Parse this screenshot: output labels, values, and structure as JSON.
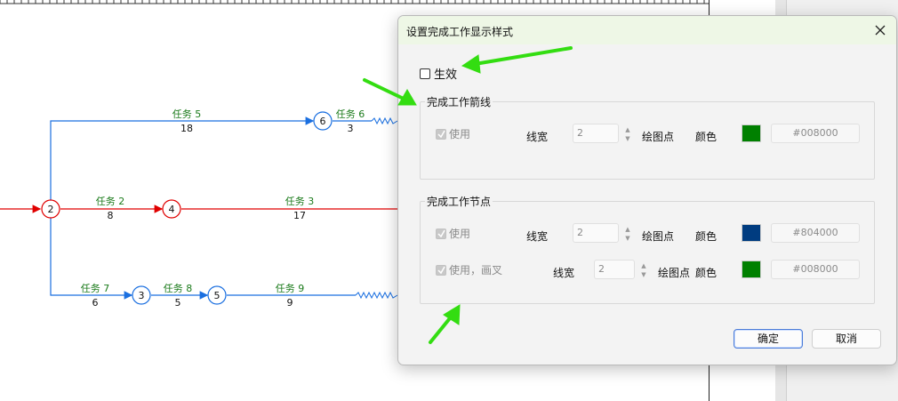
{
  "network": {
    "nodes": [
      {
        "id": "2",
        "label": "2",
        "color": "#e00000"
      },
      {
        "id": "4",
        "label": "4",
        "color": "#e00000"
      },
      {
        "id": "6",
        "label": "6",
        "color": "#1a6fe0"
      },
      {
        "id": "3",
        "label": "3",
        "color": "#1a6fe0"
      },
      {
        "id": "5",
        "label": "5",
        "color": "#1a6fe0"
      }
    ],
    "tasks": [
      {
        "name": "任务 5",
        "duration": "18"
      },
      {
        "name": "任务 6",
        "duration": "3"
      },
      {
        "name": "任务 2",
        "duration": "8"
      },
      {
        "name": "任务 3",
        "duration": "17"
      },
      {
        "name": "任务 7",
        "duration": "6"
      },
      {
        "name": "任务 8",
        "duration": "5"
      },
      {
        "name": "任务 9",
        "duration": "9"
      }
    ],
    "colors": {
      "critical": "#e00000",
      "normal": "#1a6fe0",
      "label": "#1a7a1a"
    }
  },
  "dialog": {
    "title": "设置完成工作显示样式",
    "enable_label": "生效",
    "arrow_group": {
      "title": "完成工作箭线",
      "use_label": "使用",
      "width_label": "线宽",
      "width_value": "2",
      "draw_point_label": "绘图点",
      "color_label": "颜色",
      "color_hex": "#008000",
      "color_swatch": "#008000"
    },
    "node_group": {
      "title": "完成工作节点",
      "row1": {
        "use_label": "使用",
        "width_label": "线宽",
        "width_value": "2",
        "draw_point_label": "绘图点",
        "color_label": "颜色",
        "color_hex": "#804000",
        "color_swatch": "#003c80"
      },
      "row2": {
        "use_label": "使用，画叉",
        "width_label": "线宽",
        "width_value": "2",
        "draw_point_label": "绘图点",
        "color_label": "颜色",
        "color_hex": "#008000",
        "color_swatch": "#008000"
      }
    },
    "ok_label": "确定",
    "cancel_label": "取消"
  },
  "annotation_color": "#33dd11"
}
